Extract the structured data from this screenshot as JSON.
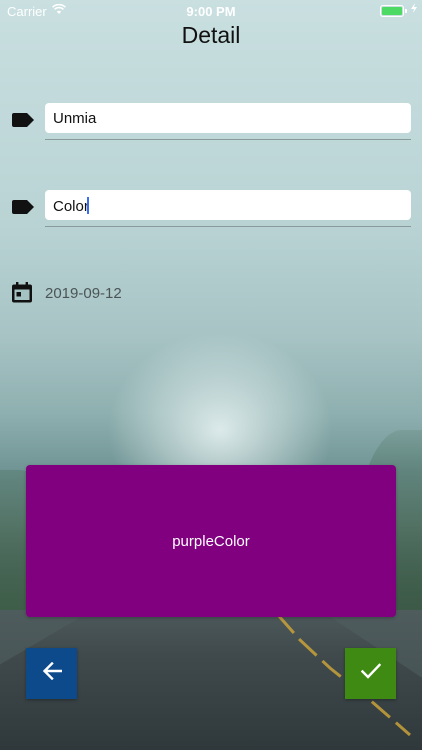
{
  "status_bar": {
    "carrier": "Carrier",
    "time": "9:00 PM"
  },
  "page": {
    "title": "Detail"
  },
  "fields": {
    "name_value": "Unmia",
    "color_value": "Color"
  },
  "date": {
    "value": "2019-09-12"
  },
  "color_card": {
    "label": "purpleColor",
    "color": "#800080"
  },
  "buttons": {
    "back_icon": "arrow-left-icon",
    "back_color": "#0c4a8c",
    "confirm_icon": "checkmark-icon",
    "confirm_color": "#3f8a12"
  }
}
